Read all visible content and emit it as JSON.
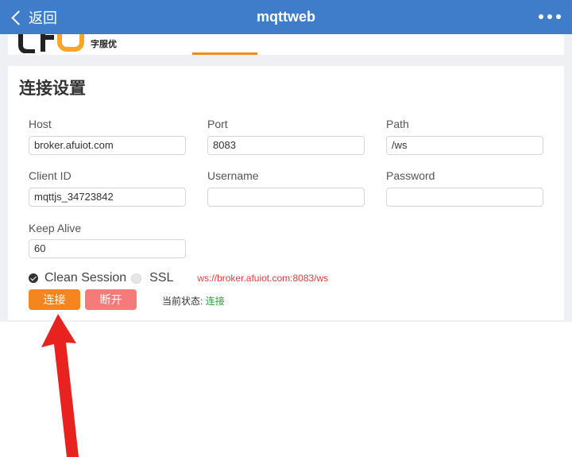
{
  "navbar": {
    "back_label": "返回",
    "title": "mqttweb"
  },
  "header": {
    "logo_cn": "字服优"
  },
  "settings": {
    "title": "连接设置",
    "host": {
      "label": "Host",
      "value": "broker.afuiot.com"
    },
    "port": {
      "label": "Port",
      "value": "8083"
    },
    "path": {
      "label": "Path",
      "value": "/ws"
    },
    "client_id": {
      "label": "Client ID",
      "value": "mqttjs_34723842"
    },
    "username": {
      "label": "Username",
      "value": ""
    },
    "password": {
      "label": "Password",
      "value": ""
    },
    "keep_alive": {
      "label": "Keep Alive",
      "value": "60"
    },
    "clean_session": {
      "label": "Clean Session",
      "checked": true
    },
    "ssl": {
      "label": "SSL",
      "checked": false
    },
    "ws_url": "ws://broker.afuiot.com:8083/ws",
    "connect_label": "连接",
    "disconnect_label": "断开",
    "status_label": "当前状态:",
    "status_value": "连接"
  },
  "colors": {
    "navbar": "#3f7cc9",
    "accent": "#f5851f",
    "disconnect": "#f57a7a",
    "status_ok": "#2e9e3e",
    "url_text": "#e23b3b",
    "annotation_arrow": "#e8231f"
  }
}
